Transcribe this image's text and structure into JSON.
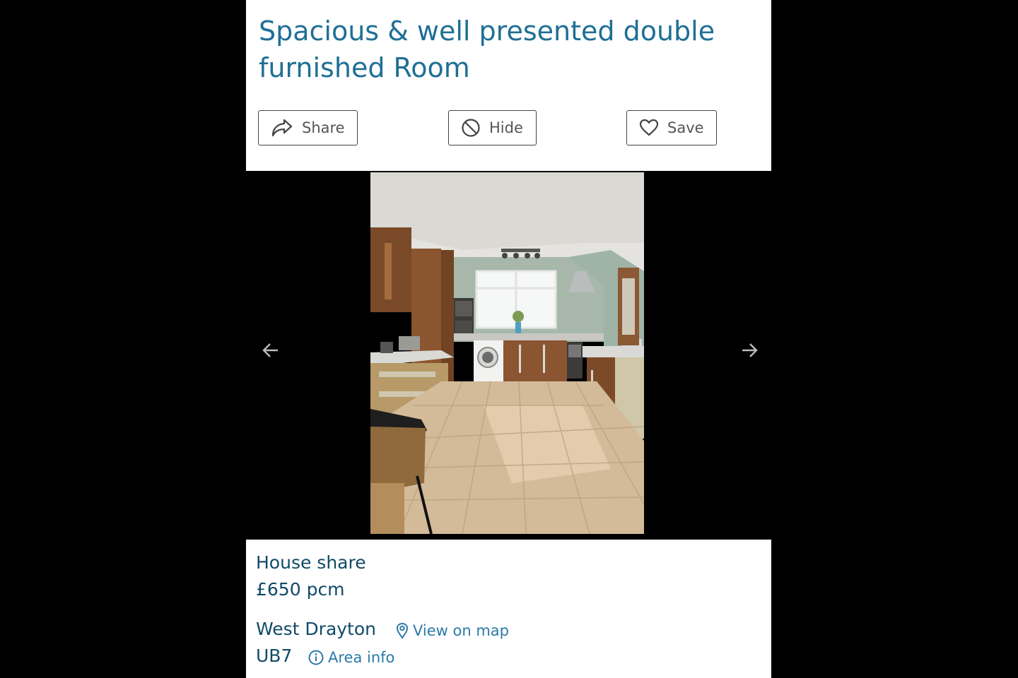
{
  "listing": {
    "title": "Spacious & well presented double furnished Room",
    "actions": {
      "share_label": "Share",
      "hide_label": "Hide",
      "save_label": "Save"
    },
    "gallery": {
      "photo_alt": "Kitchen with wooden cabinets, washing machine, window and tiled floor",
      "prev_icon": "arrow-left-icon",
      "next_icon": "arrow-right-icon"
    },
    "details": {
      "type": "House share",
      "price": "£650 pcm",
      "location": "West Drayton",
      "map_link": "View on map",
      "postcode": "UB7",
      "area_link": "Area info"
    }
  },
  "colors": {
    "title": "#1f6f95",
    "detail_text": "#114a68",
    "link": "#2b7aa8",
    "background": "#000000",
    "panel": "#ffffff"
  }
}
